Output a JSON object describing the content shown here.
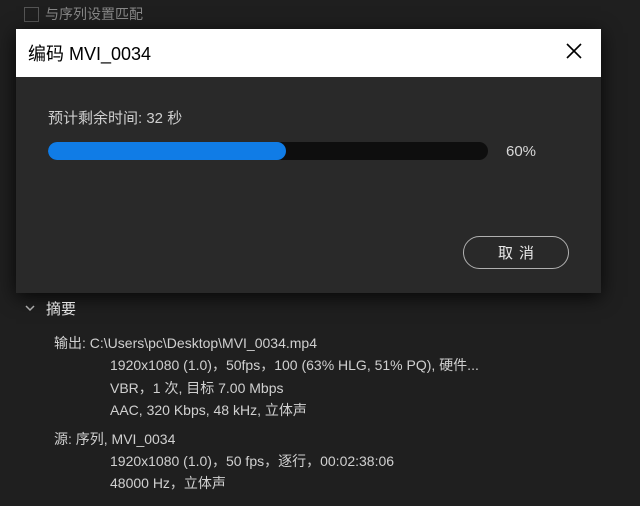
{
  "bg": {
    "checkbox_label": "与序列设置匹配"
  },
  "dialog": {
    "title": "编码 MVI_0034",
    "eta_label": "预计剩余时间: 32 秒",
    "progress_pct": "60%",
    "progress_value": 60,
    "cancel_label": "取消"
  },
  "summary": {
    "title": "摘要",
    "output_label": "输出:",
    "output_path": "C:\\Users\\pc\\Desktop\\MVI_0034.mp4",
    "output_line1": "1920x1080 (1.0)，50fps，100 (63% HLG, 51% PQ), 硬件...",
    "output_line2": "VBR，1 次, 目标 7.00 Mbps",
    "output_line3": "AAC, 320 Kbps, 48  kHz, 立体声",
    "source_label": "源:",
    "source_name": "序列, MVI_0034",
    "source_line1": "1920x1080 (1.0)，50 fps，逐行，00:02:38:06",
    "source_line2": "48000 Hz，立体声"
  }
}
